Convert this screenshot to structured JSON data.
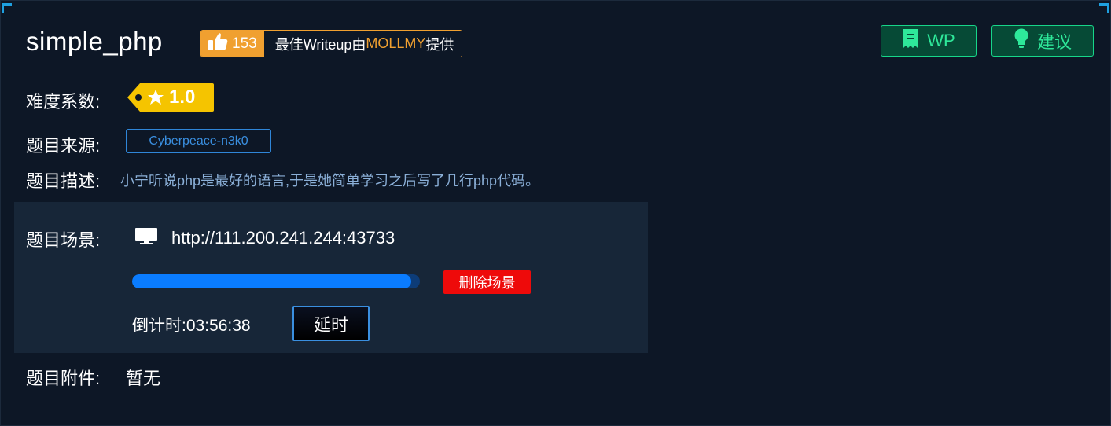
{
  "challenge": {
    "title": "simple_php",
    "likes": "153",
    "writeup_prefix": "最佳Writeup由",
    "writeup_author": "MOLLMY",
    "writeup_suffix": "提供"
  },
  "actions": {
    "wp_label": "WP",
    "suggest_label": "建议"
  },
  "fields": {
    "difficulty_label": "难度系数:",
    "difficulty_value": "1.0",
    "source_label": "题目来源:",
    "source_value": "Cyberpeace-n3k0",
    "description_label": "题目描述:",
    "description_value": "小宁听说php是最好的语言,于是她简单学习之后写了几行php代码。",
    "scene_label": "题目场景:",
    "scene_url": "http://111.200.241.244:43733",
    "delete_scene_label": "删除场景",
    "countdown_label": "倒计时:",
    "countdown_value": "03:56:38",
    "extend_label": "延时",
    "attachment_label": "题目附件:",
    "attachment_value": "暂无"
  },
  "progress": {
    "percent": 97
  },
  "colors": {
    "background": "#0d1726",
    "panel": "#172638",
    "accent_orange": "#f0a030",
    "accent_green": "#17d68a",
    "accent_blue": "#0a7cff",
    "danger_red": "#ee0a0a",
    "difficulty_yellow": "#f5c400"
  },
  "icons": {
    "like": "thumbs-up-icon",
    "wp": "document-icon",
    "suggest": "lightbulb-icon",
    "difficulty": "star-icon",
    "scene": "monitor-icon"
  }
}
